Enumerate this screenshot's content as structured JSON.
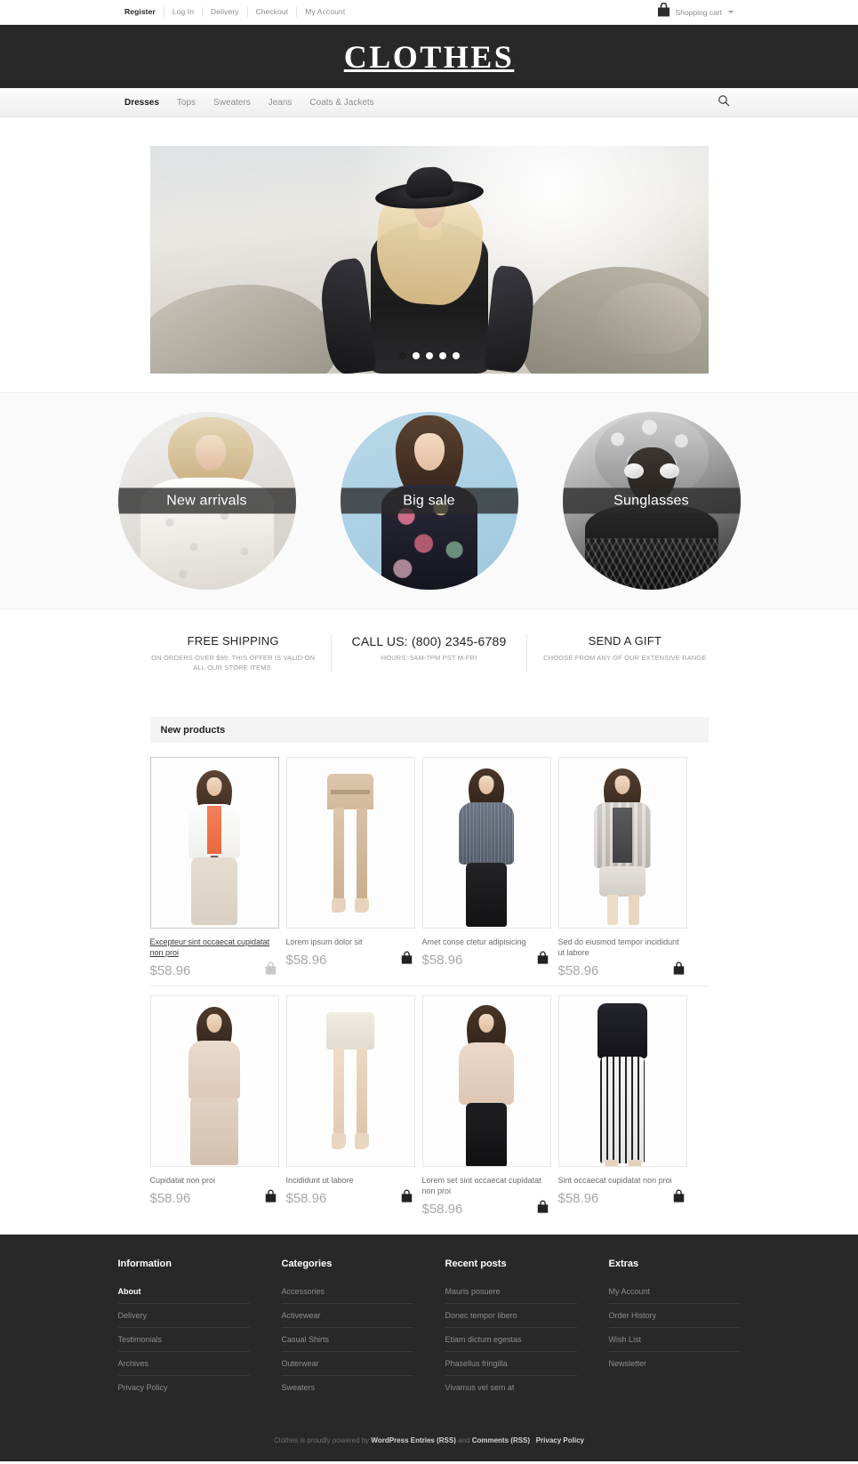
{
  "topbar": {
    "links": [
      {
        "label": "Register",
        "name": "topnav-register"
      },
      {
        "label": "Log In",
        "name": "topnav-login"
      },
      {
        "label": "Delivery",
        "name": "topnav-delivery"
      },
      {
        "label": "Checkout",
        "name": "topnav-checkout"
      },
      {
        "label": "My Account",
        "name": "topnav-my-account"
      }
    ],
    "cart_label": "Shopping cart",
    "cart_icon": "shopping-bag-icon"
  },
  "header": {
    "logo": "CLOTHES",
    "bg_color": "#282828"
  },
  "mainnav": {
    "items": [
      {
        "label": "Dresses",
        "active": true
      },
      {
        "label": "Tops",
        "active": false
      },
      {
        "label": "Sweaters",
        "active": false
      },
      {
        "label": "Jeans",
        "active": false
      },
      {
        "label": "Coats & Jackets",
        "active": false
      }
    ],
    "search_icon": "search-icon"
  },
  "slider": {
    "slides_count": 5,
    "active_index": 0,
    "alt": "Blonde model in black hat and sheer black top"
  },
  "categories": [
    {
      "label": "New arrivals",
      "name": "category-new-arrivals"
    },
    {
      "label": "Big sale",
      "name": "category-big-sale"
    },
    {
      "label": "Sunglasses",
      "name": "category-sunglasses"
    }
  ],
  "info_bar": [
    {
      "title": "FREE SHIPPING",
      "subtitle": "ON ORDERS OVER $99. THIS OFFER IS VALID ON ALL OUR STORE ITEMS."
    },
    {
      "title": "CALL US: (800) 2345-6789",
      "subtitle": "HOURS: 9AM-7PM PST M-FRI"
    },
    {
      "title": "SEND A GIFT",
      "subtitle": "CHOOSE FROM ANY OF OUR EXTENSIVE RANGE"
    }
  ],
  "products_panel": {
    "title": "New products"
  },
  "products": [
    {
      "name": "Excepteur sint occaecat cupidatat non proi",
      "price": "$58.96",
      "active": true,
      "cart_icon": "add-to-cart-icon"
    },
    {
      "name": "Lorem ipsum dolor sit",
      "price": "$58.96",
      "active": false,
      "cart_icon": "add-to-cart-icon"
    },
    {
      "name": "Amet conse ctetur adipisicing",
      "price": "$58.96",
      "active": false,
      "cart_icon": "add-to-cart-icon"
    },
    {
      "name": "Sed do eiusmod tempor incididunt ut labore",
      "price": "$58.96",
      "active": false,
      "cart_icon": "add-to-cart-icon"
    },
    {
      "name": "Cupidatat non proi",
      "price": "$58.96",
      "active": false,
      "cart_icon": "add-to-cart-icon"
    },
    {
      "name": "Incididunt ut labore",
      "price": "$58.96",
      "active": false,
      "cart_icon": "add-to-cart-icon"
    },
    {
      "name": "Lorem set sint occaecat cupidatat non proi",
      "price": "$58.96",
      "active": false,
      "cart_icon": "add-to-cart-icon"
    },
    {
      "name": "Sint occaecat cupidatat non proi",
      "price": "$58.96",
      "active": false,
      "cart_icon": "add-to-cart-icon"
    }
  ],
  "footer": {
    "columns": [
      {
        "title": "Information",
        "items": [
          {
            "label": "About",
            "active": true
          },
          {
            "label": "Delivery",
            "active": false
          },
          {
            "label": "Testimonials",
            "active": false
          },
          {
            "label": "Archives",
            "active": false
          },
          {
            "label": "Privacy Policy",
            "active": false
          }
        ]
      },
      {
        "title": "Categories",
        "items": [
          {
            "label": "Accessories",
            "active": false
          },
          {
            "label": "Activewear",
            "active": false
          },
          {
            "label": "Casual Shirts",
            "active": false
          },
          {
            "label": "Outerwear",
            "active": false
          },
          {
            "label": "Sweaters",
            "active": false
          }
        ]
      },
      {
        "title": "Recent posts",
        "items": [
          {
            "label": "Mauris posuere",
            "active": false
          },
          {
            "label": "Donec tempor libero",
            "active": false
          },
          {
            "label": "Etiam dictum egestas",
            "active": false
          },
          {
            "label": "Phasellus fringilla",
            "active": false
          },
          {
            "label": "Vivamus vel sem at",
            "active": false
          }
        ]
      },
      {
        "title": "Extras",
        "items": [
          {
            "label": "My Account",
            "active": false
          },
          {
            "label": "Order History",
            "active": false
          },
          {
            "label": "Wish List",
            "active": false
          },
          {
            "label": "Newsletter",
            "active": false
          }
        ]
      }
    ],
    "copyright": {
      "prefix": "Clothes is proudly powered by",
      "link1": "WordPress Entries (RSS)",
      "mid": "and",
      "link2": "Comments (RSS)",
      "link3": "Privacy Policy"
    }
  }
}
